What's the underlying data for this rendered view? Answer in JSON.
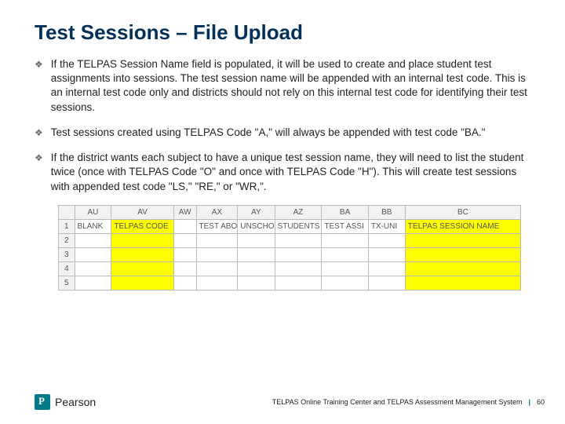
{
  "title": "Test Sessions – File Upload",
  "bullets": [
    "If the TELPAS Session Name field is populated, it will be used to create and place student test assignments into sessions. The test session name will be appended with an internal test code.  This is an internal test code only and districts should not rely on this internal test code for identifying their test sessions.",
    "Test sessions created using TELPAS Code \"A,\" will always be appended with test code \"BA.\"",
    "If the district wants each subject to have a unique test session name, they will need to list the student twice (once with TELPAS Code \"O\" and once with TELPAS Code \"H\"). This will create test sessions with appended test code \"LS,\" \"RE,\" or \"WR,\"."
  ],
  "sheet": {
    "columns": [
      "AU",
      "AV",
      "AW",
      "AX",
      "AY",
      "AZ",
      "BA",
      "BB",
      "BC"
    ],
    "row1": [
      "BLANK",
      "TELPAS CODE",
      "",
      "TEST ABO",
      "UNSCHO",
      "STUDENTS",
      "TEST ASSI",
      "TX-UNI",
      "TELPAS SESSION NAME"
    ],
    "highlight": [
      false,
      true,
      false,
      false,
      false,
      false,
      false,
      false,
      true
    ],
    "rowNumbers": [
      "1",
      "2",
      "3",
      "4",
      "5"
    ]
  },
  "footer": {
    "brand": "Pearson",
    "text": "TELPAS Online Training Center and TELPAS Assessment Management System",
    "page": "60"
  }
}
